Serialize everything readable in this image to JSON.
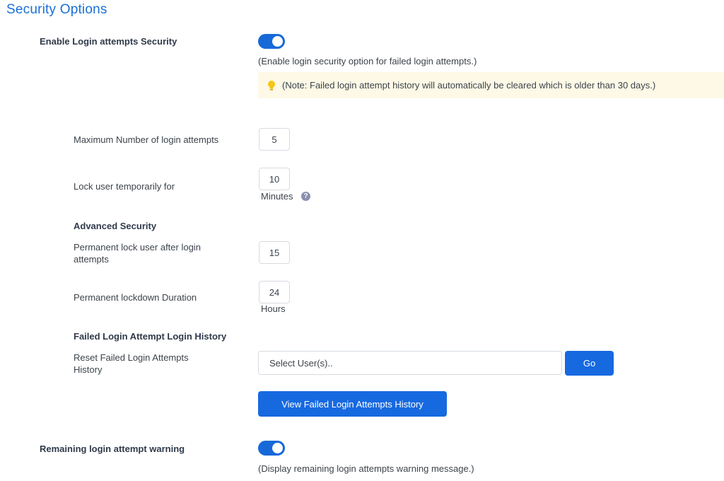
{
  "title": "Security Options",
  "login_security": {
    "label": "Enable Login attempts Security",
    "enabled": true,
    "description": "(Enable login security option for failed login attempts.)",
    "note": "(Note: Failed login attempt history will automatically be cleared which is older than 30 days.)"
  },
  "max_attempts": {
    "label": "Maximum Number of login attempts",
    "value": "5"
  },
  "lock_temp": {
    "label": "Lock user temporarily for",
    "value": "10",
    "unit": "Minutes"
  },
  "advanced": {
    "heading": "Advanced Security",
    "perm_lock_label": "Permanent lock user after login attempts",
    "perm_lock_value": "15",
    "duration_label": "Permanent lockdown Duration",
    "duration_value": "24",
    "duration_unit": "Hours"
  },
  "history": {
    "heading": "Failed Login Attempt Login History",
    "reset_label": "Reset Failed Login Attempts History",
    "select_placeholder": "Select User(s)..",
    "go_label": "Go",
    "view_button": "View Failed Login Attempts History"
  },
  "remaining_warning": {
    "label": "Remaining login attempt warning",
    "enabled": true,
    "description": "(Display remaining login attempts warning message.)"
  },
  "colors": {
    "accent": "#1769d8",
    "title": "#1a6fd6",
    "note_bg": "#fdf9e6"
  },
  "icons": {
    "note": "lightbulb-icon",
    "help": "question-circle-icon"
  }
}
